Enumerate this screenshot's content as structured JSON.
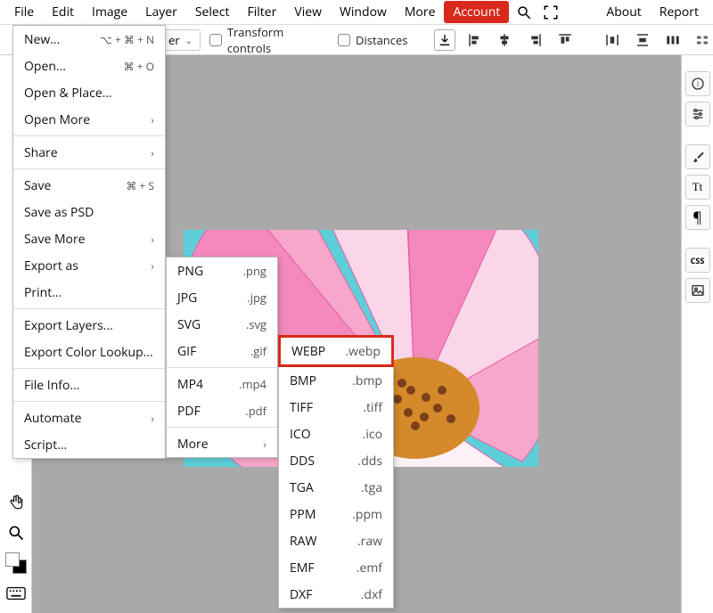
{
  "menubar": {
    "file": "File",
    "edit": "Edit",
    "image": "Image",
    "layer": "Layer",
    "select": "Select",
    "filter": "Filter",
    "view": "View",
    "window": "Window",
    "more": "More",
    "account": "Account",
    "about": "About",
    "report": "Report"
  },
  "toolbar": {
    "order_label": "er",
    "transform_label": "Transform controls",
    "distances_label": "Distances"
  },
  "file_menu": {
    "new": "New...",
    "new_sc": "⌥ + ⌘ + N",
    "open": "Open...",
    "open_sc": "⌘ + O",
    "open_place": "Open & Place...",
    "open_more": "Open More",
    "share": "Share",
    "save": "Save",
    "save_sc": "⌘ + S",
    "save_psd": "Save as PSD",
    "save_more": "Save More",
    "export_as": "Export as",
    "print": "Print...",
    "export_layers": "Export Layers...",
    "export_clut": "Export Color Lookup...",
    "file_info": "File Info...",
    "automate": "Automate",
    "script": "Script..."
  },
  "export_menu": {
    "png_l": "PNG",
    "png_e": ".png",
    "jpg_l": "JPG",
    "jpg_e": ".jpg",
    "svg_l": "SVG",
    "svg_e": ".svg",
    "gif_l": "GIF",
    "gif_e": ".gif",
    "mp4_l": "MP4",
    "mp4_e": ".mp4",
    "pdf_l": "PDF",
    "pdf_e": ".pdf",
    "more": "More"
  },
  "more_menu": {
    "webp_l": "WEBP",
    "webp_e": ".webp",
    "bmp_l": "BMP",
    "bmp_e": ".bmp",
    "tiff_l": "TIFF",
    "tiff_e": ".tiff",
    "ico_l": "ICO",
    "ico_e": ".ico",
    "dds_l": "DDS",
    "dds_e": ".dds",
    "tga_l": "TGA",
    "tga_e": ".tga",
    "ppm_l": "PPM",
    "ppm_e": ".ppm",
    "raw_l": "RAW",
    "raw_e": ".raw",
    "emf_l": "EMF",
    "emf_e": ".emf",
    "dxf_l": "DXF",
    "dxf_e": ".dxf"
  },
  "right_labels": {
    "tt": "Tt",
    "para": "¶",
    "css": "CSS"
  },
  "embed": "<>"
}
